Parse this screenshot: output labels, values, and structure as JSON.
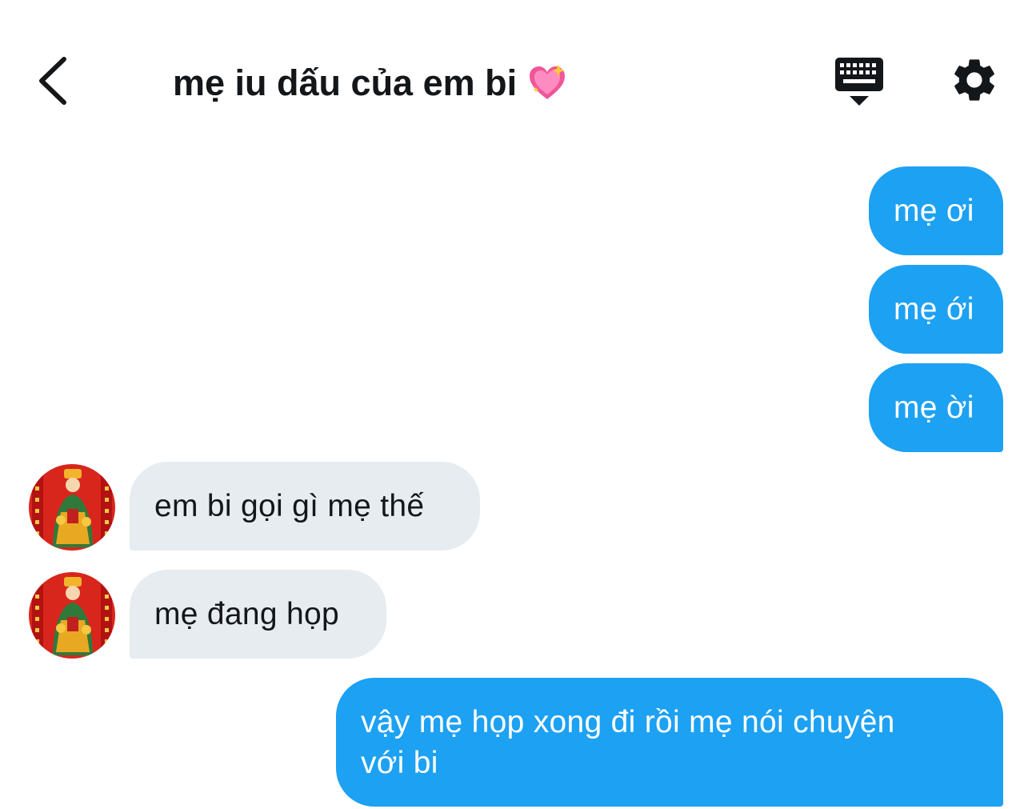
{
  "header": {
    "title": "mẹ iu dấu của em bi",
    "title_icon": "sparkling-heart-icon",
    "back_icon": "chevron-left-icon",
    "keyboard_icon": "keyboard-hide-icon",
    "settings_icon": "gear-icon"
  },
  "messages": [
    {
      "sender": "me",
      "text": "mẹ ơi"
    },
    {
      "sender": "me",
      "text": "mẹ ới"
    },
    {
      "sender": "me",
      "text": "mẹ ời"
    },
    {
      "sender": "contact",
      "text": "em bi gọi gì mẹ thế",
      "avatar": "god-of-wealth-avatar"
    },
    {
      "sender": "contact",
      "text": "mẹ đang họp",
      "avatar": "god-of-wealth-avatar"
    },
    {
      "sender": "me",
      "text": "vậy mẹ họp xong đi rồi mẹ nói chuyện\nvới bi"
    }
  ],
  "colors": {
    "outgoing_bubble": "#1da1f2",
    "incoming_bubble": "#e6ecf0",
    "text_dark": "#14171a",
    "text_light": "#ffffff"
  }
}
